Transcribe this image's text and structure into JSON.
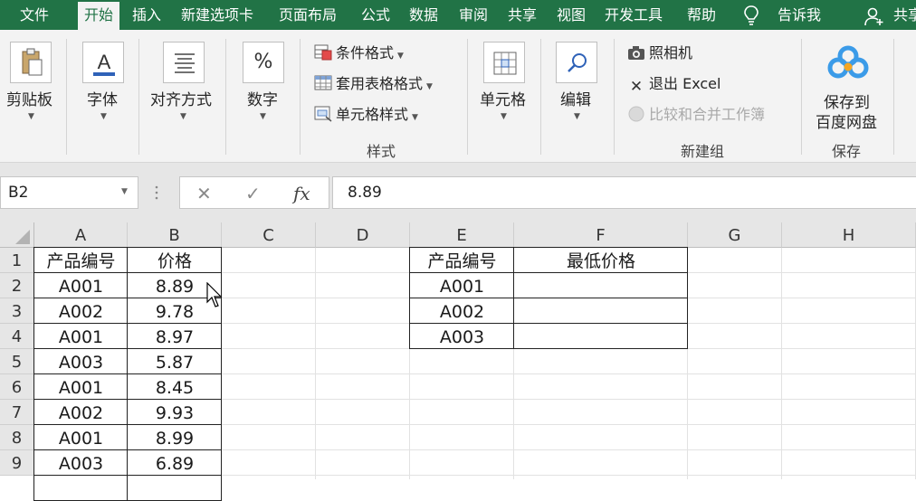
{
  "ribbon_tabs": [
    "文件",
    "开始",
    "插入",
    "新建选项卡",
    "页面布局",
    "公式",
    "数据",
    "审阅",
    "共享",
    "视图",
    "开发工具",
    "帮助",
    "告诉我",
    "共享"
  ],
  "clipboard": {
    "paste_label": "剪贴板"
  },
  "font": {
    "label": "字体"
  },
  "alignment": {
    "label": "对齐方式"
  },
  "number": {
    "label": "数字",
    "icon_glyph": "%"
  },
  "styles": {
    "conditional_format": "条件格式",
    "table_format": "套用表格格式",
    "cell_style": "单元格样式",
    "group_label": "样式"
  },
  "cells_group": {
    "label": "单元格"
  },
  "editing": {
    "label": "编辑"
  },
  "new_group": {
    "camera": "照相机",
    "exit_excel": "退出 Excel",
    "compare_merge": "比较和合并工作簿",
    "group_label": "新建组"
  },
  "save_group": {
    "save_to_line1": "保存到",
    "save_to_line2": "百度网盘",
    "group_label": "保存"
  },
  "formula_bar": {
    "name_box": "B2",
    "cancel_glyph": "✕",
    "enter_glyph": "✓",
    "fx_glyph": "fx",
    "formula": "8.89"
  },
  "sheet": {
    "columns": [
      "A",
      "B",
      "C",
      "D",
      "E",
      "F",
      "G",
      "H"
    ],
    "rows": [
      "1",
      "2",
      "3",
      "4",
      "5",
      "6",
      "7",
      "8",
      "9"
    ],
    "table1": {
      "headers": [
        "产品编号",
        "价格"
      ],
      "rows": [
        [
          "A001",
          "8.89"
        ],
        [
          "A002",
          "9.78"
        ],
        [
          "A001",
          "8.97"
        ],
        [
          "A003",
          "5.87"
        ],
        [
          "A001",
          "8.45"
        ],
        [
          "A002",
          "9.93"
        ],
        [
          "A001",
          "8.99"
        ],
        [
          "A003",
          "6.89"
        ]
      ]
    },
    "table2": {
      "headers": [
        "产品编号",
        "最低价格"
      ],
      "rows": [
        [
          "A001",
          ""
        ],
        [
          "A002",
          ""
        ],
        [
          "A003",
          ""
        ]
      ]
    }
  },
  "colors": {
    "accent": "#217346",
    "ribbon_bg": "#f3f3f3",
    "header_bg": "#e6e6e6"
  }
}
